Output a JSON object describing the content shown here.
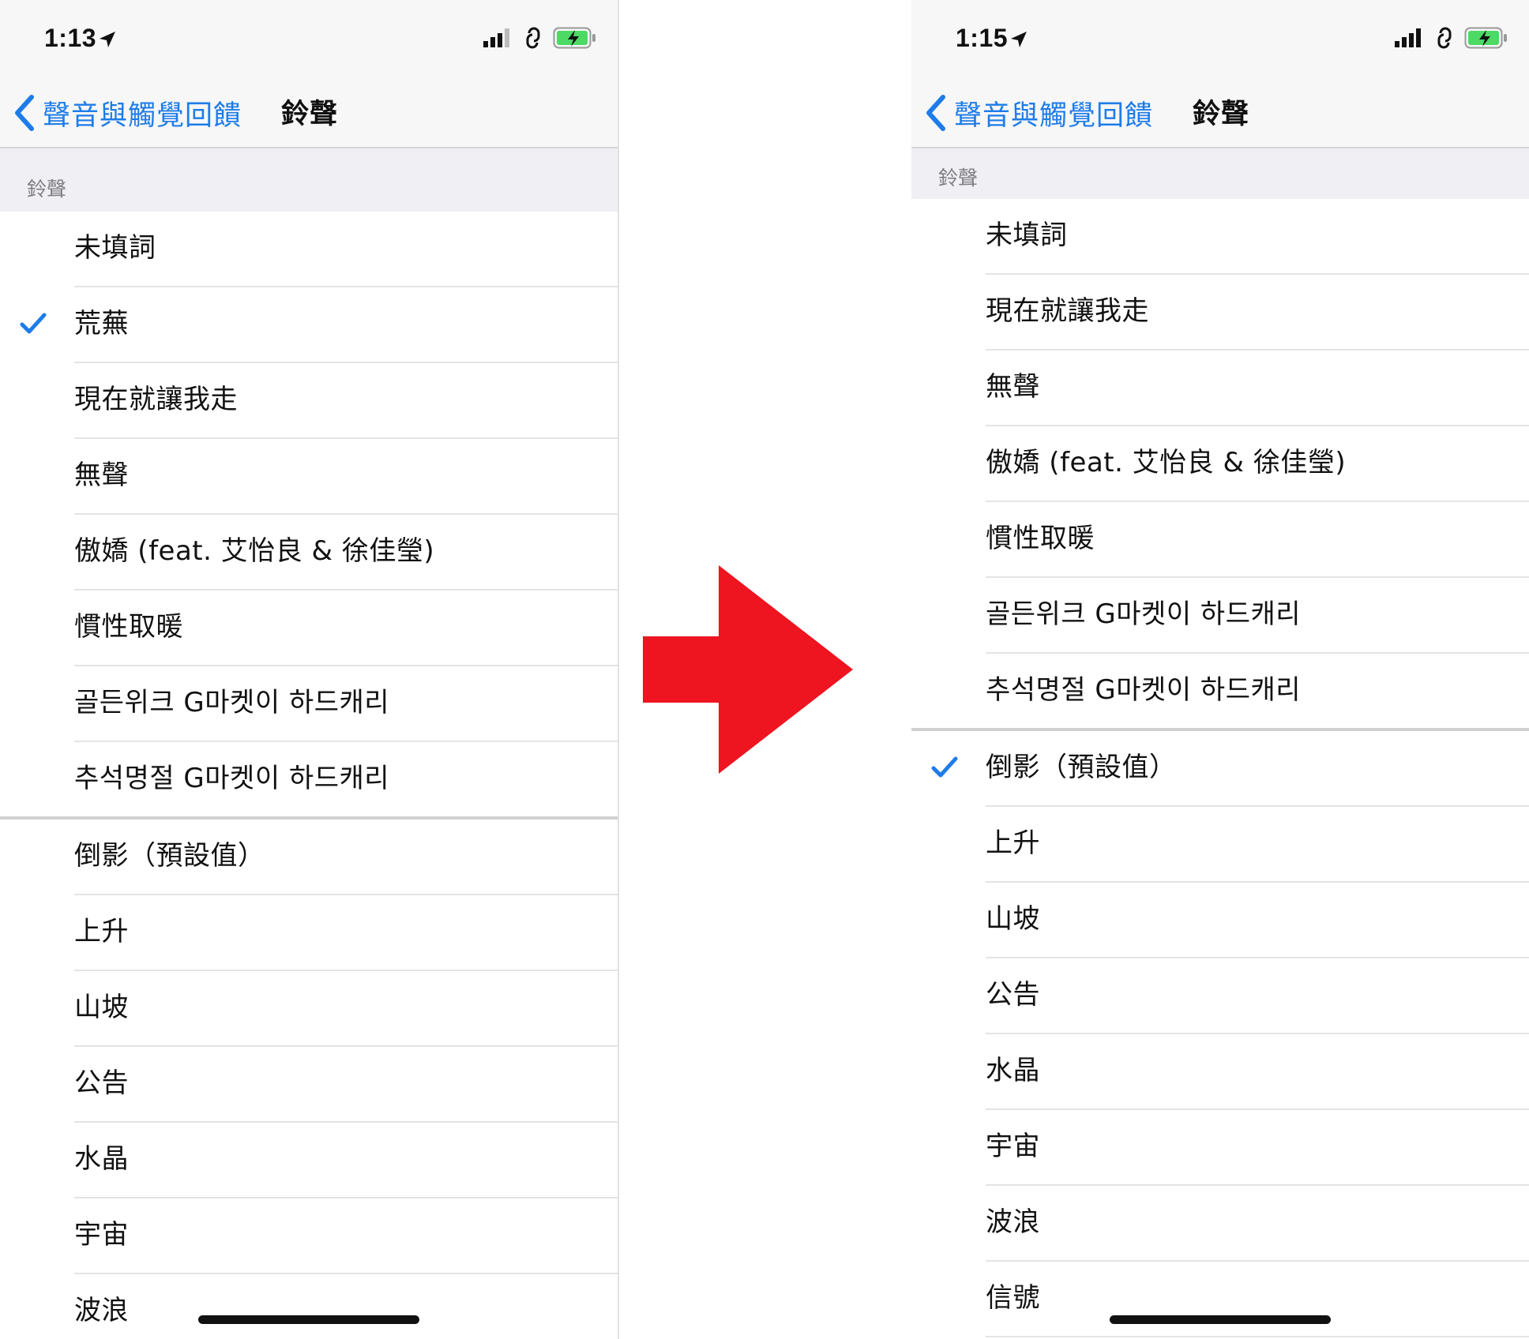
{
  "colors": {
    "accent": "#1e7ce8",
    "arrow": "#ee1420",
    "battery": "#4cd964"
  },
  "left": {
    "status_time": "1:13",
    "back_label": "聲音與觸覺回饋",
    "title": "鈴聲",
    "section_label": "鈴聲",
    "custom_ringtones": [
      "未填詞",
      "荒蕪",
      "現在就讓我走",
      "無聲",
      "傲嬌 (feat. 艾怡良 & 徐佳瑩)",
      "慣性取暖",
      "골든위크 G마켓이 하드캐리",
      "추석명절 G마켓이 하드캐리"
    ],
    "system_ringtones": [
      "倒影（預設值）",
      "上升",
      "山坡",
      "公告",
      "水晶",
      "宇宙",
      "波浪"
    ],
    "selected": "荒蕪"
  },
  "right": {
    "status_time": "1:15",
    "back_label": "聲音與觸覺回饋",
    "title": "鈴聲",
    "section_label": "鈴聲",
    "custom_ringtones": [
      "未填詞",
      "現在就讓我走",
      "無聲",
      "傲嬌 (feat. 艾怡良 & 徐佳瑩)",
      "慣性取暖",
      "골든위크 G마켓이 하드캐리",
      "추석명절 G마켓이 하드캐리"
    ],
    "system_ringtones": [
      "倒影（預設值）",
      "上升",
      "山坡",
      "公告",
      "水晶",
      "宇宙",
      "波浪",
      "信號"
    ],
    "selected": "倒影（預設值）"
  }
}
